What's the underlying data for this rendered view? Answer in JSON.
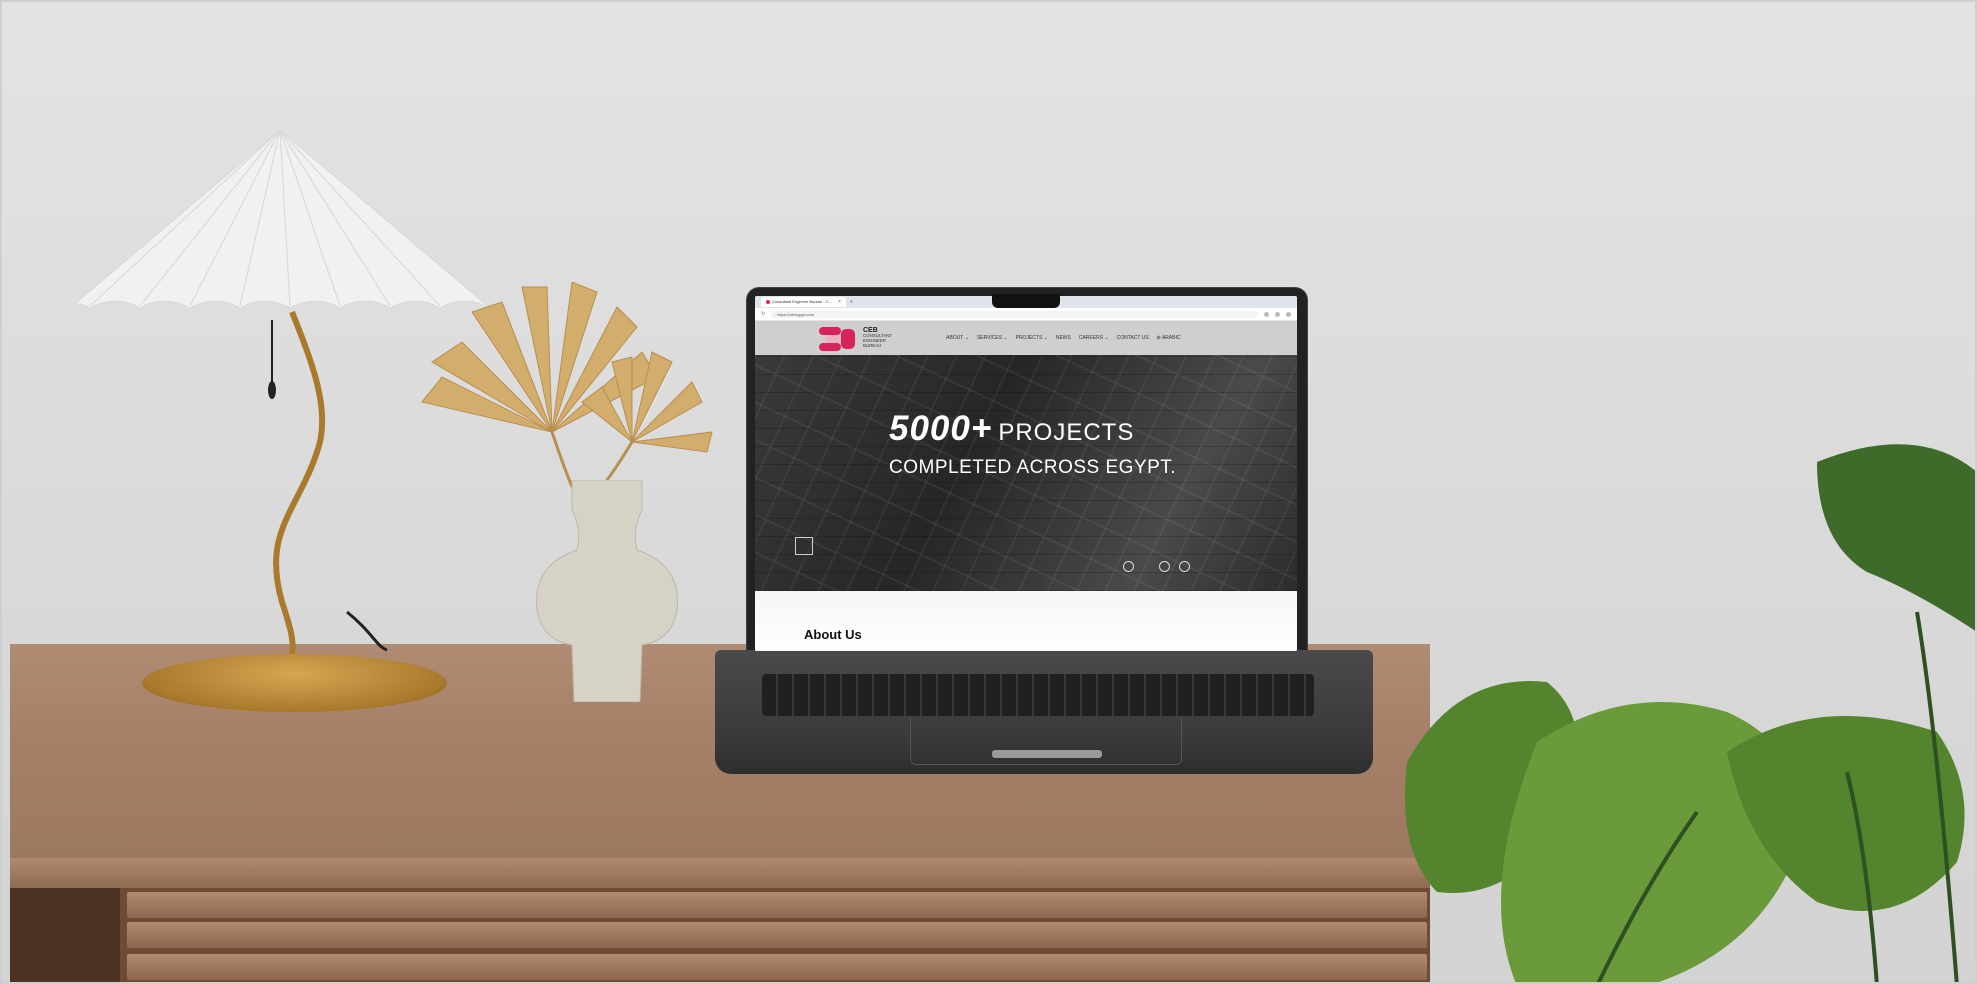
{
  "browser": {
    "tab_title": "Consultant Engineer Bureau - C...",
    "tab_close": "×",
    "tab_new": "+",
    "url": "https://cebegypt.com"
  },
  "site": {
    "logo_abbr": "CEB",
    "logo_line1": "CONSULTANT",
    "logo_line2": "ENGINEER",
    "logo_line3": "BUREAU",
    "nav": [
      {
        "label": "ABOUT ⌄"
      },
      {
        "label": "SERVICES ⌄"
      },
      {
        "label": "PROJECTS ⌄"
      },
      {
        "label": "NEWS"
      },
      {
        "label": "CAREERS ⌄"
      },
      {
        "label": "CONTACT US"
      },
      {
        "label": "⊕ ARABIC"
      }
    ],
    "hero": {
      "count": "5000+",
      "word": "PROJECTS",
      "subtitle": "COMPLETED ACROSS EGYPT."
    },
    "about_title": "About Us"
  },
  "colors": {
    "brand": "#d6245a",
    "desk": "#a57f67",
    "wall": "#dcdcdc"
  }
}
